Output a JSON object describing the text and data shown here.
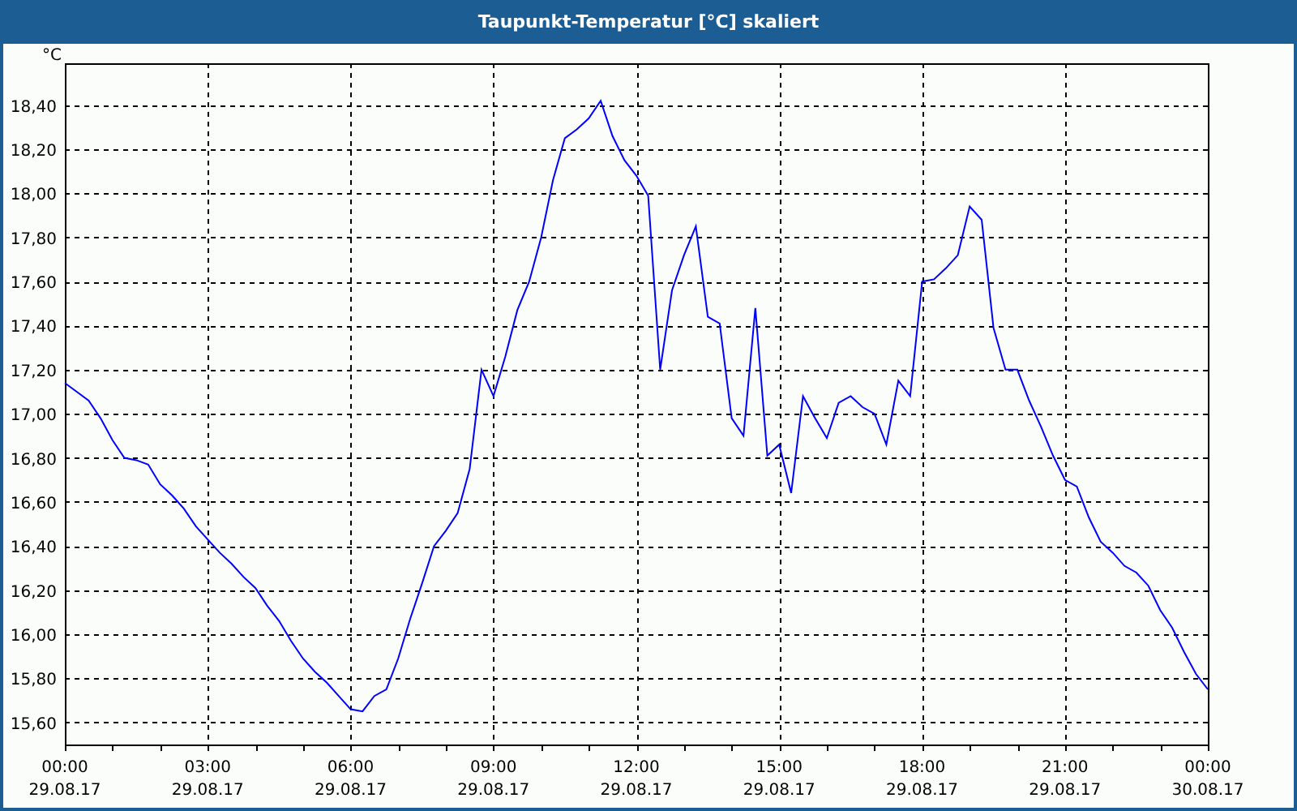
{
  "window": {
    "title": "Taupunkt-Temperatur [°C] skaliert"
  },
  "chart": {
    "chart_data": {
      "type": "line",
      "grid": true,
      "ylabel": "°C",
      "ylim": [
        15.5,
        18.59
      ],
      "categories": [
        "00:00 29.08.17",
        null,
        null,
        null,
        null,
        null,
        null,
        null,
        null,
        null,
        null,
        null,
        "03:00 29.08.17",
        null,
        null,
        null,
        null,
        null,
        null,
        null,
        null,
        null,
        null,
        null,
        "06:00 29.08.17",
        null,
        null,
        null,
        null,
        null,
        null,
        null,
        null,
        null,
        null,
        null,
        "09:00 29.08.17",
        null,
        null,
        null,
        null,
        null,
        null,
        null,
        null,
        null,
        null,
        null,
        "12:00 29.08.17",
        null,
        null,
        null,
        null,
        null,
        null,
        null,
        null,
        null,
        null,
        null,
        "15:00 29.08.17",
        null,
        null,
        null,
        null,
        null,
        null,
        null,
        null,
        null,
        null,
        null,
        "18:00 29.08.17",
        null,
        null,
        null,
        null,
        null,
        null,
        null,
        null,
        null,
        null,
        null,
        "21:00 29.08.17",
        null,
        null,
        null,
        null,
        null,
        null,
        null,
        null,
        null,
        null,
        null,
        "00:00 30.08.17"
      ],
      "yticks": [
        {
          "value": 15.6,
          "label": "15,60"
        },
        {
          "value": 15.8,
          "label": "15,80"
        },
        {
          "value": 16.0,
          "label": "16,00"
        },
        {
          "value": 16.2,
          "label": "16,20"
        },
        {
          "value": 16.4,
          "label": "16,40"
        },
        {
          "value": 16.6,
          "label": "16,60"
        },
        {
          "value": 16.8,
          "label": "16,80"
        },
        {
          "value": 17.0,
          "label": "17,00"
        },
        {
          "value": 17.2,
          "label": "17,20"
        },
        {
          "value": 17.4,
          "label": "17,40"
        },
        {
          "value": 17.6,
          "label": "17,60"
        },
        {
          "value": 17.8,
          "label": "17,80"
        },
        {
          "value": 18.0,
          "label": "18,00"
        },
        {
          "value": 18.2,
          "label": "18,20"
        },
        {
          "value": 18.4,
          "label": "18,40"
        }
      ],
      "series": [
        {
          "color": "#0000ff",
          "values": [
            17.14,
            17.1,
            17.06,
            16.98,
            16.88,
            16.8,
            16.79,
            16.77,
            16.68,
            16.63,
            16.57,
            16.49,
            16.43,
            16.37,
            16.32,
            16.26,
            16.21,
            16.13,
            16.06,
            15.97,
            15.89,
            15.83,
            15.78,
            15.72,
            15.66,
            15.65,
            15.72,
            15.75,
            15.89,
            16.07,
            16.23,
            16.4,
            16.47,
            16.55,
            16.75,
            17.2,
            17.08,
            17.26,
            17.47,
            17.6,
            17.8,
            18.06,
            18.25,
            18.29,
            18.34,
            18.42,
            18.26,
            18.15,
            18.08,
            17.99,
            17.2,
            17.56,
            17.72,
            17.85,
            17.44,
            17.41,
            16.98,
            16.9,
            17.48,
            16.81,
            16.86,
            16.64,
            17.08,
            16.98,
            16.89,
            17.05,
            17.08,
            17.03,
            17.0,
            16.86,
            17.15,
            17.08,
            17.6,
            17.61,
            17.66,
            17.72,
            17.94,
            17.88,
            17.39,
            17.2,
            17.2,
            17.06,
            16.94,
            16.81,
            16.7,
            16.67,
            16.53,
            16.42,
            16.37,
            16.31,
            16.28,
            16.22,
            16.11,
            16.03,
            15.92,
            15.82,
            15.75
          ]
        }
      ]
    }
  }
}
